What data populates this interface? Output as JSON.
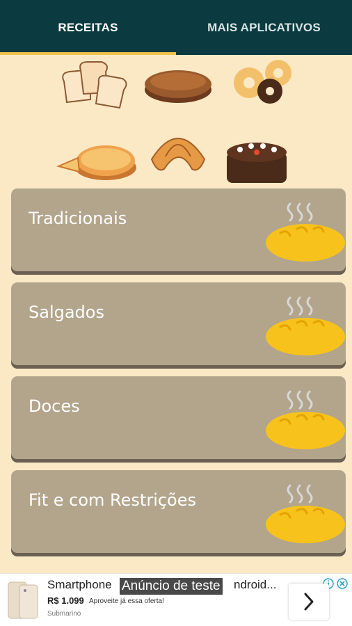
{
  "tabs": [
    {
      "label": "RECEITAS",
      "active": true
    },
    {
      "label": "MAIS APLICATIVOS",
      "active": false
    }
  ],
  "categories": [
    {
      "label": "Tradicionais",
      "icon": "bread-icon"
    },
    {
      "label": "Salgados",
      "icon": "bread-icon"
    },
    {
      "label": "Doces",
      "icon": "bread-icon"
    },
    {
      "label": "Fit e com Restrições",
      "icon": "bread-icon"
    }
  ],
  "ad": {
    "title": "Smartphone",
    "title_tail": "ndroid...",
    "test_badge": "Anúncio de teste",
    "price": "R$ 1.099",
    "promo": "Aproveite já essa oferta!",
    "store": "Submarino"
  },
  "colors": {
    "background": "#fbe9c6",
    "tabbar": "#0b3a40",
    "indicator": "#f1c24a",
    "card": "#b3a58c",
    "bread": "#f7c21c"
  }
}
